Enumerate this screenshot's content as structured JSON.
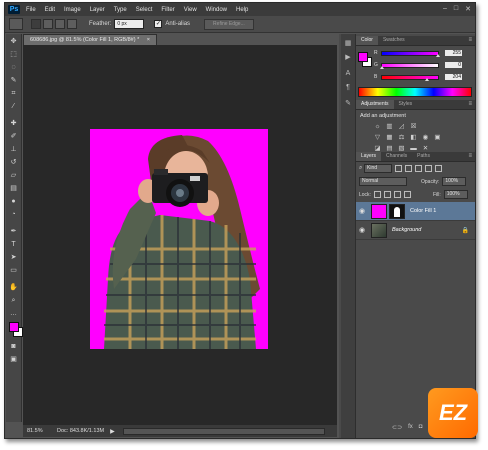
{
  "app": {
    "logo": "Ps"
  },
  "menu": [
    "File",
    "Edit",
    "Image",
    "Layer",
    "Type",
    "Select",
    "Filter",
    "View",
    "Window",
    "Help"
  ],
  "window_controls": [
    "–",
    "□",
    "✕"
  ],
  "options_bar": {
    "feather_label": "Feather:",
    "feather_value": "0 px",
    "anti_alias_label": "Anti-alias",
    "refine_edge_label": "Refine Edge..."
  },
  "document": {
    "tab_title": "608686.jpg @ 81.5% (Color Fill 1, RGB/8#) *",
    "tab_close": "×"
  },
  "status": {
    "zoom": "81.5%",
    "doc_size": "Doc: 843.8K/1.13M",
    "arrow": "▶"
  },
  "color_panel": {
    "tabs": [
      "Color",
      "Swatches"
    ],
    "foreground": "#ff00ff",
    "background": "#ffffff",
    "channels": [
      {
        "label": "R",
        "value": "255",
        "level": 1.0,
        "gradient": "linear-gradient(to right,#0000ff,#ff00ff)"
      },
      {
        "label": "G",
        "value": "0",
        "level": 0.0,
        "gradient": "linear-gradient(to right,#ff00ff,#ffffff)"
      },
      {
        "label": "B",
        "value": "204",
        "level": 0.8,
        "gradient": "linear-gradient(to right,#ff0000,#ff00ff)"
      }
    ]
  },
  "adjustments_panel": {
    "tabs": [
      "Adjustments",
      "Styles"
    ],
    "title": "Add an adjustment",
    "icons": [
      "brightness-icon",
      "levels-icon",
      "curves-icon",
      "exposure-icon",
      "vibrance-icon",
      "hue-saturation-icon",
      "color-balance-icon",
      "black-white-icon",
      "photo-filter-icon",
      "channel-mixer-icon",
      "invert-icon",
      "posterize-icon",
      "threshold-icon",
      "gradient-map-icon",
      "selective-color-icon"
    ],
    "glyphs": [
      "☼",
      "▥",
      "◿",
      "☒",
      "▽",
      "▦",
      "⚖",
      "◧",
      "◉",
      "▣",
      "◪",
      "▤",
      "▧",
      "▬",
      "✕"
    ]
  },
  "layers_panel": {
    "tabs": [
      "Layers",
      "Channels",
      "Paths"
    ],
    "kind_label": "Kind",
    "blend_mode": "Normal",
    "opacity_label": "Opacity:",
    "opacity_value": "100%",
    "lock_label": "Lock:",
    "fill_label": "Fill:",
    "fill_value": "100%",
    "layers": [
      {
        "name": "Color Fill 1",
        "selected": true
      },
      {
        "name": "Background",
        "selected": false,
        "locked": true
      }
    ],
    "footer_icons": [
      "⊂⊃",
      "fx",
      "◘",
      "◐",
      "▭",
      "▢",
      "🗑"
    ]
  },
  "watermark": {
    "text": "EZ"
  }
}
